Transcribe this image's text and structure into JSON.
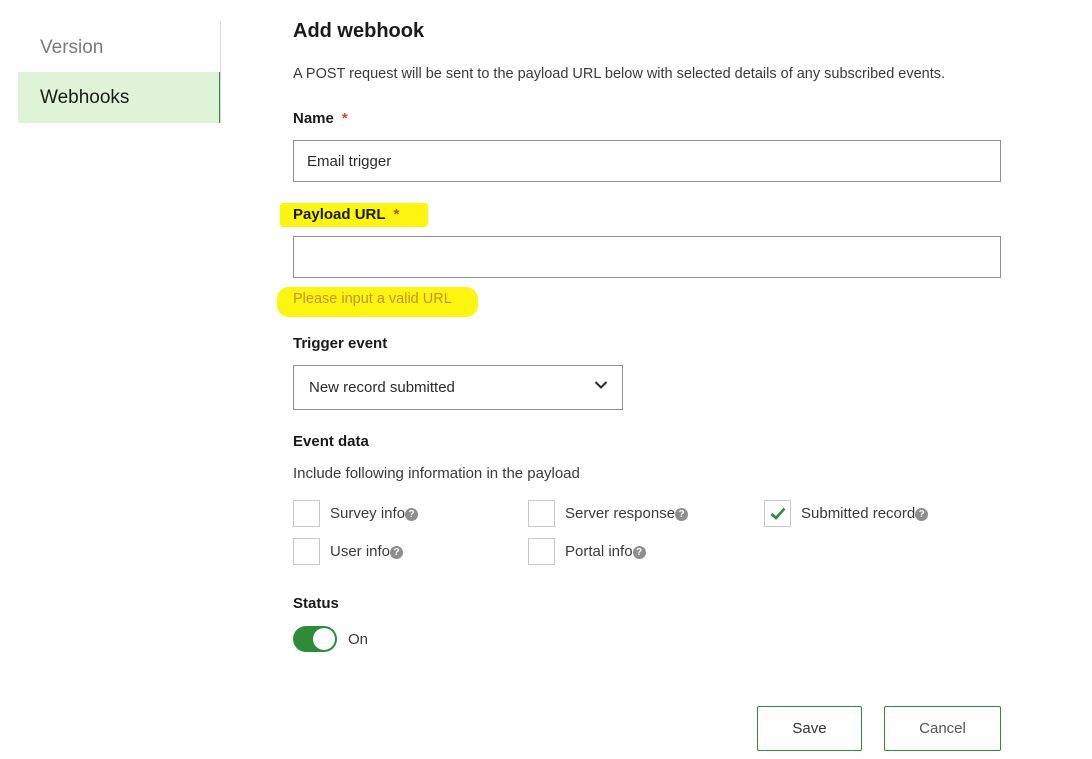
{
  "sidebar": {
    "items": [
      {
        "label": "Version"
      },
      {
        "label": "Webhooks",
        "active": true
      }
    ]
  },
  "form": {
    "title": "Add webhook",
    "description": "A POST request will be sent to the payload URL below with selected details of any subscribed events.",
    "required_marker": "*",
    "name": {
      "label": "Name",
      "value": "Email trigger"
    },
    "payload_url": {
      "label": "Payload URL",
      "value": "",
      "error": "Please input a valid URL",
      "highlight_color": "#fbf50f"
    },
    "trigger_event": {
      "label": "Trigger event",
      "selected": "New record submitted",
      "icon": "chevron-down-icon"
    },
    "event_data": {
      "label": "Event data",
      "subtitle": "Include following information in the payload",
      "options": [
        {
          "label": "Survey info",
          "checked": false
        },
        {
          "label": "Server response",
          "checked": false
        },
        {
          "label": "Submitted record",
          "checked": true
        },
        {
          "label": "User info",
          "checked": false
        },
        {
          "label": "Portal info",
          "checked": false
        }
      ],
      "help_icon": "question-circle-icon"
    },
    "status": {
      "label": "Status",
      "state_label": "On",
      "on": true
    },
    "buttons": {
      "save": "Save",
      "cancel": "Cancel"
    }
  },
  "colors": {
    "accent": "#2e8b38",
    "active_bg": "#dff3d8",
    "required": "#d0432b",
    "error_text": "#c7922a"
  }
}
